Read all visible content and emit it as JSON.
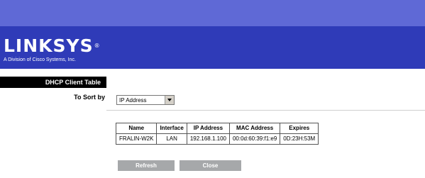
{
  "header": {
    "logo_text": "LINKSYS",
    "logo_mark": "®",
    "tagline": "A Division of Cisco Systems, Inc."
  },
  "section": {
    "title": "DHCP Client Table"
  },
  "sort": {
    "label": "To Sort by",
    "selected": "IP Address"
  },
  "table": {
    "headers": [
      "Name",
      "Interface",
      "IP Address",
      "MAC Address",
      "Expires"
    ],
    "rows": [
      [
        "FRALIN-W2K",
        "LAN",
        "192.168.1.100",
        "00:0d:60:39:f1:e9",
        "0D:23H:53M"
      ]
    ]
  },
  "buttons": {
    "refresh": "Refresh",
    "close": "Close"
  },
  "colors": {
    "top_band": "#5f69d6",
    "header": "#2f3bb8",
    "section_bar": "#000000",
    "button": "#a6a8aa"
  }
}
